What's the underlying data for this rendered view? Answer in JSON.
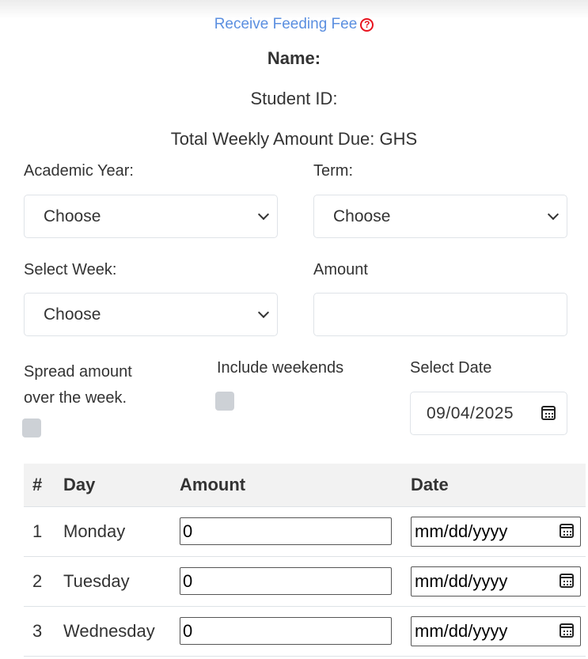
{
  "header": {
    "link_text": "Receive Feeding Fee",
    "help_glyph": "?",
    "accent": "#5b8fe0",
    "help_color": "#e8141f"
  },
  "student": {
    "name_label": "Name:",
    "id_label": "Student ID:",
    "total_label": "Total Weekly Amount Due: GHS"
  },
  "form": {
    "academic_year": {
      "label": "Academic Year:",
      "value": "Choose"
    },
    "term": {
      "label": "Term:",
      "value": "Choose"
    },
    "select_week": {
      "label": "Select Week:",
      "value": "Choose"
    },
    "amount": {
      "label": "Amount",
      "value": ""
    },
    "spread": {
      "label_line1": "Spread amount",
      "label_line2": "over the week.",
      "checked": false
    },
    "weekends": {
      "label": "Include weekends",
      "checked": false
    },
    "select_date": {
      "label": "Select Date",
      "value": "09/04/2025",
      "icon": "calendar-icon"
    }
  },
  "table": {
    "headers": [
      "#",
      "Day",
      "Amount",
      "Date"
    ],
    "rows": [
      {
        "num": "1",
        "day": "Monday",
        "amount": "0",
        "date": "mm/dd/yyyy"
      },
      {
        "num": "2",
        "day": "Tuesday",
        "amount": "0",
        "date": "mm/dd/yyyy"
      },
      {
        "num": "3",
        "day": "Wednesday",
        "amount": "0",
        "date": "mm/dd/yyyy"
      }
    ]
  }
}
